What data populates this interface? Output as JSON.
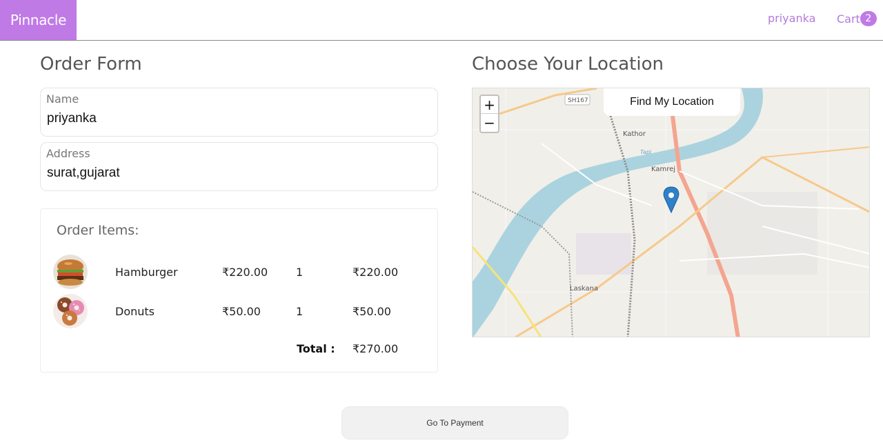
{
  "header": {
    "brand": "Pinnacle",
    "user": "priyanka",
    "cart_label": "Cart",
    "cart_count": "2",
    "brand_color": "#c07ae6"
  },
  "order_form": {
    "title": "Order Form",
    "name_label": "Name",
    "name_value": "priyanka",
    "address_label": "Address",
    "address_value": "surat,gujarat"
  },
  "order_items": {
    "title": "Order Items:",
    "items": [
      {
        "name": "Hamburger",
        "price": "₹220.00",
        "qty": "1",
        "subtotal": "₹220.00",
        "icon": "hamburger-image"
      },
      {
        "name": "Donuts",
        "price": "₹50.00",
        "qty": "1",
        "subtotal": "₹50.00",
        "icon": "donuts-image"
      }
    ],
    "total_label": "Total :",
    "total_value": "₹270.00"
  },
  "location": {
    "title": "Choose Your Location",
    "find_button": "Find My Location",
    "zoom_in": "+",
    "zoom_out": "−",
    "map_labels": {
      "road_sh": "SH167",
      "kathor": "Kathor",
      "tapi": "Tapi",
      "kamrej": "Kamrej",
      "laskana": "Laskana"
    }
  },
  "payment": {
    "button": "Go To Payment"
  }
}
